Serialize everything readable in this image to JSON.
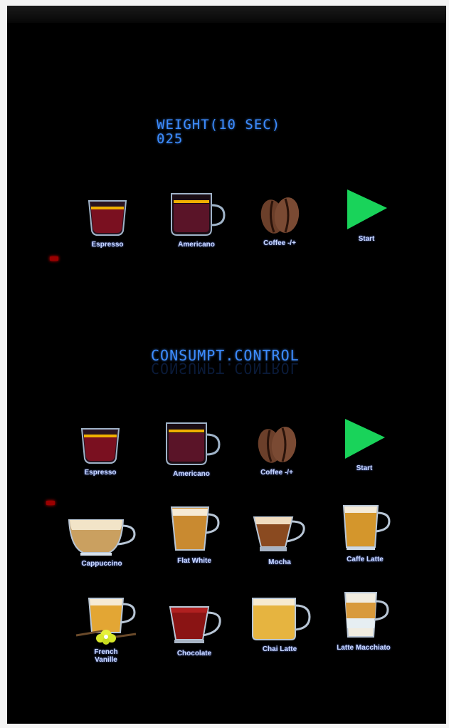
{
  "display": {
    "weight_title": "WEIGHT(10 SEC)",
    "weight_value": "025",
    "consumption_title": "CONSUMPT.CONTROL"
  },
  "panel_top": {
    "buttons": [
      {
        "label": "Espresso",
        "icon": "espresso-cup-icon"
      },
      {
        "label": "Americano",
        "icon": "americano-mug-icon"
      },
      {
        "label": "Coffee -/+",
        "icon": "coffee-bean-icon"
      },
      {
        "label": "Start",
        "icon": "play-icon"
      }
    ]
  },
  "panel_bottom": {
    "buttons": [
      {
        "label": "Espresso",
        "icon": "espresso-cup-icon"
      },
      {
        "label": "Americano",
        "icon": "americano-mug-icon"
      },
      {
        "label": "Coffee -/+",
        "icon": "coffee-bean-icon"
      },
      {
        "label": "Start",
        "icon": "play-icon"
      },
      {
        "label": "Cappuccino",
        "icon": "cappuccino-cup-icon"
      },
      {
        "label": "Flat White",
        "icon": "flat-white-glass-icon"
      },
      {
        "label": "Mocha",
        "icon": "mocha-cup-icon"
      },
      {
        "label": "Caffe Latte",
        "icon": "caffe-latte-glass-icon"
      },
      {
        "label": "French Vanille",
        "icon": "french-vanilla-cup-icon"
      },
      {
        "label": "Chocolate",
        "icon": "chocolate-cup-icon"
      },
      {
        "label": "Chai Latte",
        "icon": "chai-latte-mug-icon"
      },
      {
        "label": "Latte Macchiato",
        "icon": "latte-macchiato-glass-icon"
      }
    ]
  },
  "colors": {
    "background": "#000000",
    "lcd_blue": "#3d8cff",
    "start_green": "#19d35a",
    "indicator_red": "#b00000"
  }
}
